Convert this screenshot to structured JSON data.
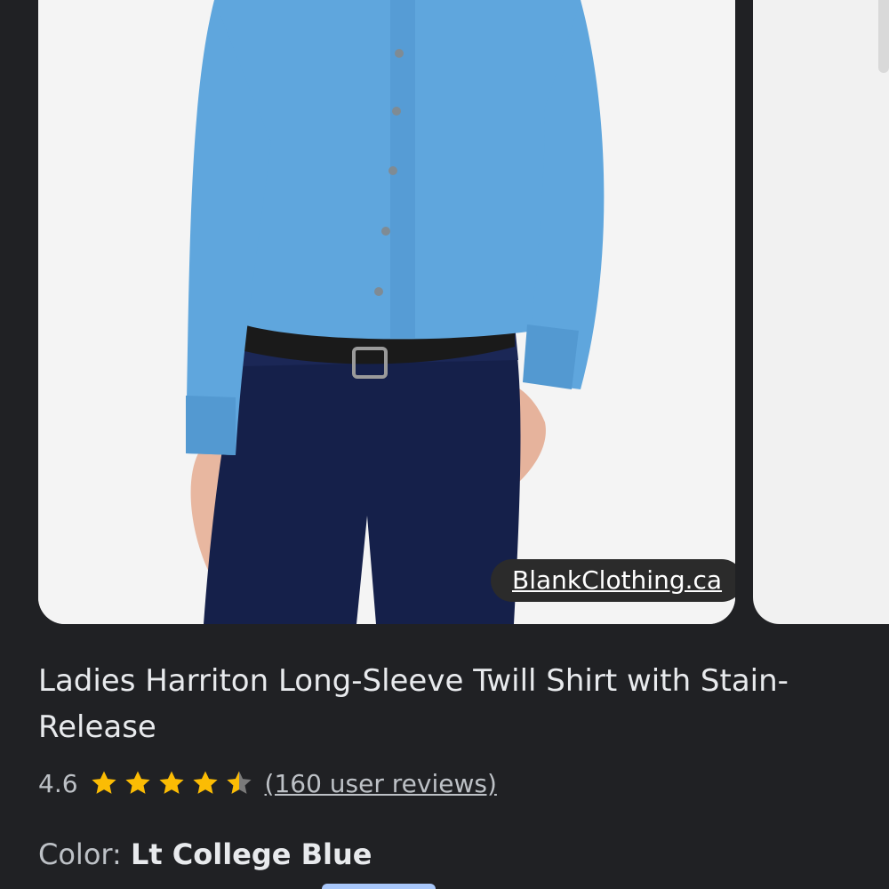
{
  "product": {
    "source": "BlankClothing.ca",
    "title": "Ladies Harriton Long-Sleeve Twill Shirt with Stain-Release",
    "rating": "4.6",
    "stars": 4.6,
    "reviews": "(160 user reviews)",
    "color_label": "Color:",
    "color_value": "Lt College Blue"
  },
  "colors": {
    "background": "#202124",
    "shirt": "#5fa6dd",
    "pants": "#15204a",
    "star": "#fbbc04"
  },
  "icons": {
    "star": "star-icon"
  }
}
